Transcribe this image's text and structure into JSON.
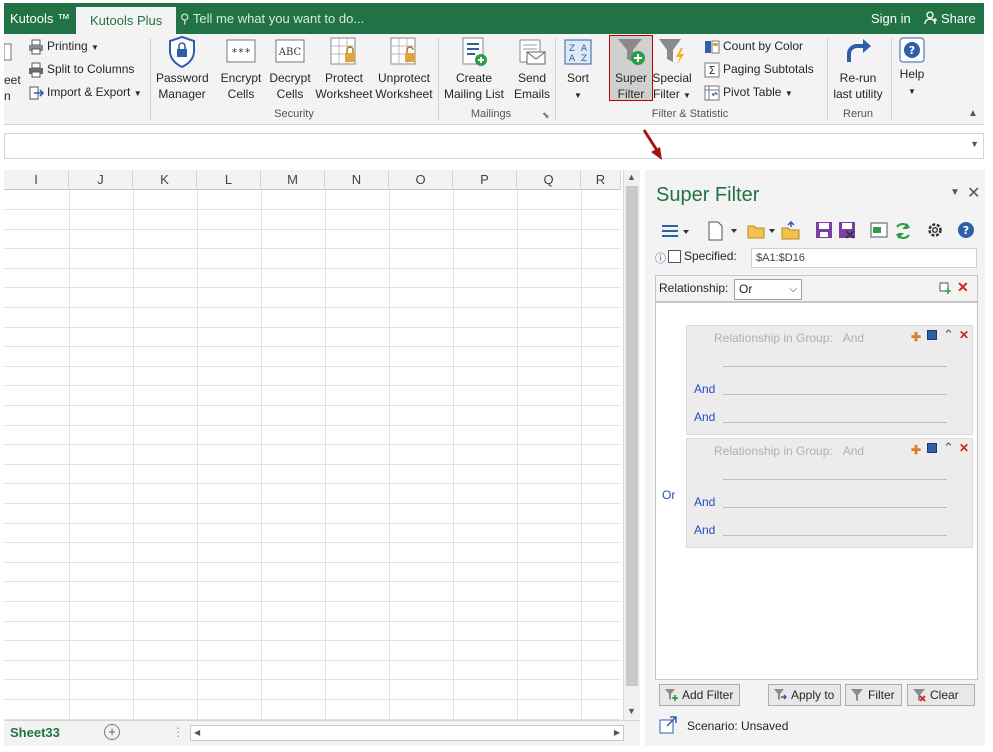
{
  "titlebar": {
    "tabs": [
      "Kutools ™",
      "Kutools Plus"
    ],
    "tell_me_placeholder": "Tell me what you want to do...",
    "sign_in": "Sign in",
    "share": "Share"
  },
  "ribbon": {
    "partial_left": [
      "eet",
      "n"
    ],
    "workbook_items": [
      "Printing",
      "Split to Columns",
      "Import & Export"
    ],
    "security": {
      "label": "Security",
      "buttons": [
        {
          "line1": "Password",
          "line2": "Manager"
        },
        {
          "line1": "Encrypt",
          "line2": "Cells"
        },
        {
          "line1": "Decrypt",
          "line2": "Cells"
        },
        {
          "line1": "Protect",
          "line2": "Worksheet"
        },
        {
          "line1": "Unprotect",
          "line2": "Worksheet"
        }
      ]
    },
    "mailings": {
      "label": "Mailings",
      "buttons": [
        {
          "line1": "Create",
          "line2": "Mailing List"
        },
        {
          "line1": "Send",
          "line2": "Emails"
        }
      ]
    },
    "filter_statistic": {
      "label": "Filter & Statistic",
      "sort": "Sort",
      "super_filter": {
        "line1": "Super",
        "line2": "Filter"
      },
      "special_filter": {
        "line1": "Special",
        "line2": "Filter"
      },
      "small_items": [
        "Count by Color",
        "Paging Subtotals",
        "Pivot Table"
      ]
    },
    "rerun": {
      "label": "Rerun",
      "line1": "Re-run",
      "line2": "last utility"
    },
    "help": {
      "label": "Help"
    }
  },
  "grid": {
    "columns": [
      "I",
      "J",
      "K",
      "L",
      "M",
      "N",
      "O",
      "P",
      "Q",
      "R"
    ],
    "sheet_tab": "Sheet33"
  },
  "super_filter": {
    "title": "Super Filter",
    "specified_label": "Specified:",
    "specified_range": "$A1:$D16",
    "relationship_label": "Relationship:",
    "relationship_value": "Or",
    "outer_relation": "Or",
    "groups": [
      {
        "header": "Relationship in Group:",
        "value": "And",
        "conditions": [
          "And",
          "And"
        ]
      },
      {
        "header": "Relationship in Group:",
        "value": "And",
        "conditions": [
          "And",
          "And"
        ]
      }
    ],
    "buttons": {
      "add_filter": "Add Filter",
      "apply_to": "Apply to",
      "filter": "Filter",
      "clear": "Clear"
    },
    "scenario_label": "Scenario:",
    "scenario_value": "Unsaved"
  },
  "colors": {
    "excel_green": "#217346",
    "and_blue": "#1f4fbf",
    "arrow_red": "#a31515"
  }
}
